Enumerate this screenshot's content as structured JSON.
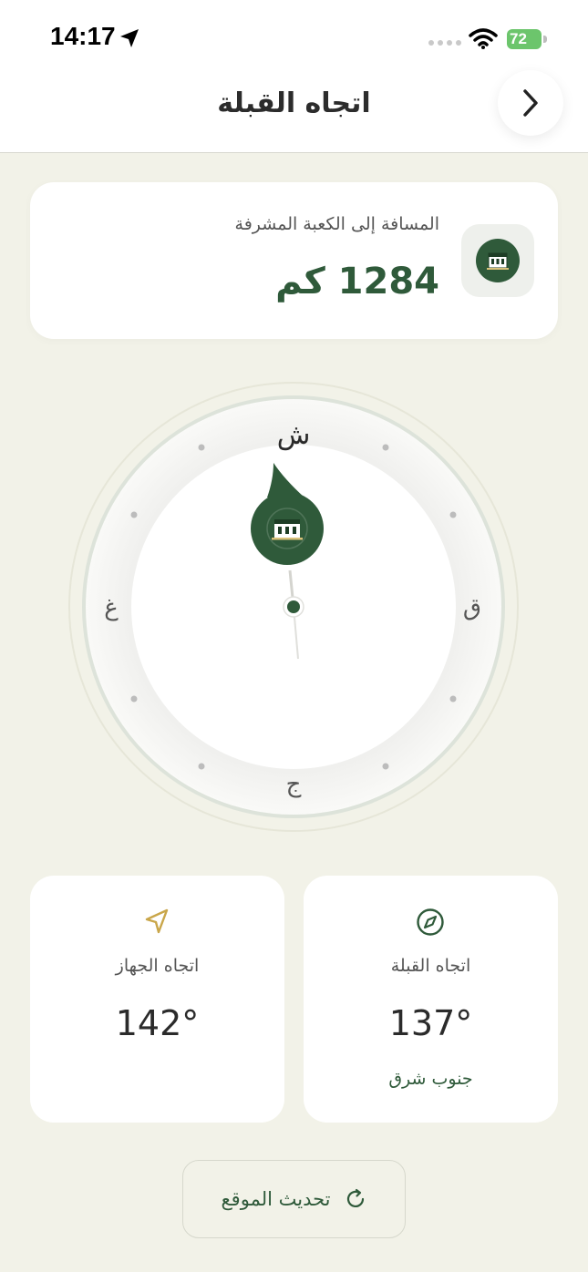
{
  "status_bar": {
    "time": "14:17",
    "battery": "72",
    "icons": [
      "location-arrow-icon",
      "cellular-signal-icon",
      "wifi-icon",
      "battery-charging-icon"
    ]
  },
  "header": {
    "title": "اتجاه القبلة",
    "back_icon": "chevron-right-icon"
  },
  "distance": {
    "label": "المسافة إلى الكعبة المشرفة",
    "value": "1284 كم",
    "icon": "kaaba-icon"
  },
  "compass": {
    "north": "ش",
    "east": "ق",
    "south": "ج",
    "west": "غ",
    "qibla_icon": "kaaba-icon"
  },
  "device_card": {
    "icon": "navigation-arrow-icon",
    "label": "اتجاه الجهاز",
    "value": "142°"
  },
  "qibla_card": {
    "icon": "compass-icon",
    "label": "اتجاه القبلة",
    "value": "137°",
    "direction": "جنوب شرق"
  },
  "refresh": {
    "label": "تحديث الموقع",
    "icon": "refresh-icon"
  },
  "colors": {
    "accent": "#2f5a3a",
    "background": "#f2f2e8",
    "gold": "#c9a64a"
  }
}
